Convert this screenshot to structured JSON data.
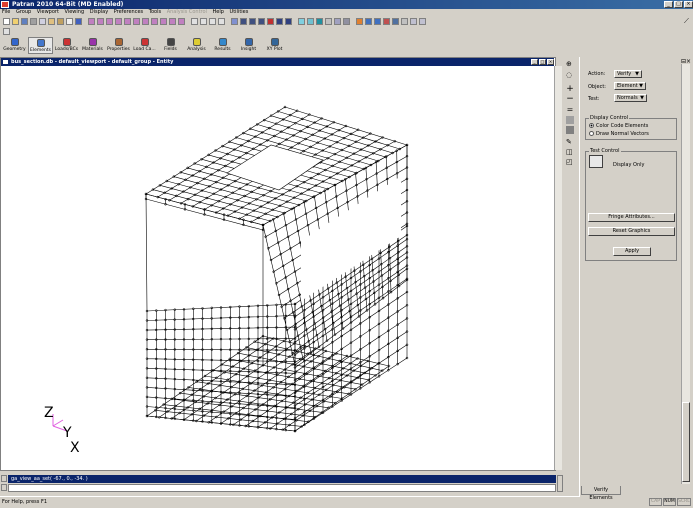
{
  "window": {
    "title": "Patran 2010 64-Bit (MD Enabled)"
  },
  "menu": [
    {
      "label": "File",
      "disabled": false
    },
    {
      "label": "Group",
      "disabled": false
    },
    {
      "label": "Viewport",
      "disabled": false
    },
    {
      "label": "Viewing",
      "disabled": false
    },
    {
      "label": "Display",
      "disabled": false
    },
    {
      "label": "Preferences",
      "disabled": false
    },
    {
      "label": "Tools",
      "disabled": false
    },
    {
      "label": "Analysis Control",
      "disabled": true
    },
    {
      "label": "Help",
      "disabled": false
    },
    {
      "label": "Utilities",
      "disabled": false
    }
  ],
  "app_tabs": [
    {
      "label": "Geometry",
      "icon": "geometry-icon",
      "active": false,
      "color": "#3366cc"
    },
    {
      "label": "Elements",
      "icon": "elements-icon",
      "active": true,
      "color": "#4477cc"
    },
    {
      "label": "Loads/BCs",
      "icon": "loads-icon",
      "active": false,
      "color": "#cc3333"
    },
    {
      "label": "Materials",
      "icon": "materials-icon",
      "active": false,
      "color": "#9933aa"
    },
    {
      "label": "Properties",
      "icon": "properties-icon",
      "active": false,
      "color": "#aa6633"
    },
    {
      "label": "Load Ca...",
      "icon": "loadcases-icon",
      "active": false,
      "color": "#cc3333"
    },
    {
      "label": "Fields",
      "icon": "fields-icon",
      "active": false,
      "color": "#444444"
    },
    {
      "label": "Analysis",
      "icon": "analysis-icon",
      "active": false,
      "color": "#ddcc33"
    },
    {
      "label": "Results",
      "icon": "results-icon",
      "active": false,
      "color": "#3388cc"
    },
    {
      "label": "Insight",
      "icon": "insight-icon",
      "active": false,
      "color": "#3366aa"
    },
    {
      "label": "XY Plot",
      "icon": "xyplot-icon",
      "active": false,
      "color": "#336699"
    }
  ],
  "viewport": {
    "title": "bus_section.db - default_viewport - default_group - Entity",
    "triad": {
      "z": "Z",
      "y": "Y",
      "x": "X"
    }
  },
  "command": {
    "history_line": "ga_view_aa_set( -67., 0., -34. )",
    "input_value": ""
  },
  "status": {
    "help": "For Help, press F1",
    "indicators": [
      "CAP",
      "NUM",
      "SCRL"
    ]
  },
  "panel": {
    "action_label": "Action:",
    "action_value": "Verify",
    "object_label": "Object:",
    "object_value": "Element",
    "test_label": "Test:",
    "test_value": "Normals",
    "display_control": {
      "title": "Display Control",
      "options": [
        {
          "label": "Color Code Elements",
          "checked": true
        },
        {
          "label": "Draw Normal Vectors",
          "checked": false
        }
      ]
    },
    "test_control": {
      "title": "Test Control",
      "option_label": "Display Only"
    },
    "fringe_button": "Fringe Attributes...",
    "reset_button": "Reset Graphics",
    "apply_button": "Apply",
    "tab_label": "Verify Elements"
  }
}
